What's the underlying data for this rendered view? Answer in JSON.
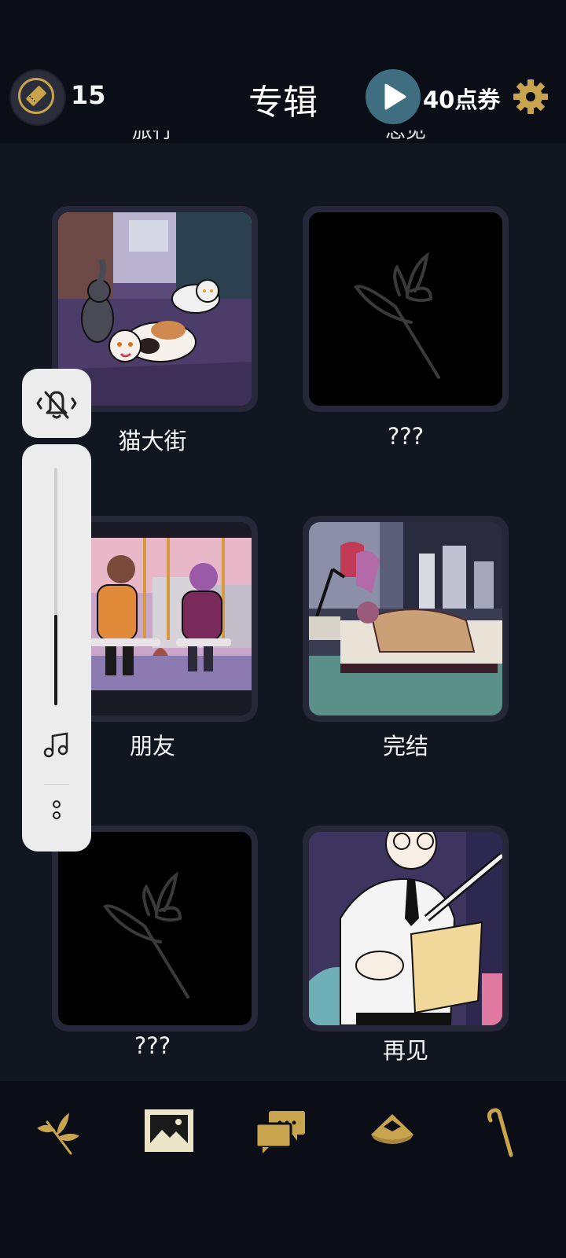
{
  "header": {
    "ticket_count": "15",
    "title": "专辑",
    "coupon_label": "40点券"
  },
  "partial_labels": [
    "旅行",
    "思见"
  ],
  "albums": [
    {
      "label": "猫大街",
      "locked": false
    },
    {
      "label": "???",
      "locked": true
    },
    {
      "label": "朋友",
      "locked": false
    },
    {
      "label": "完结",
      "locked": false
    },
    {
      "label": "???",
      "locked": true
    },
    {
      "label": "再见",
      "locked": false
    }
  ],
  "volume_level": 0.38,
  "bottom_nav": [
    {
      "icon": "flower-branch-icon"
    },
    {
      "icon": "album-picture-icon",
      "active": true
    },
    {
      "icon": "chat-bubbles-icon"
    },
    {
      "icon": "hat-icon"
    },
    {
      "icon": "cane-icon"
    }
  ],
  "colors": {
    "accent_gold": "#c9a44f",
    "background": "#121621",
    "bar": "#0b0e16",
    "play_button": "#3e6e80"
  }
}
